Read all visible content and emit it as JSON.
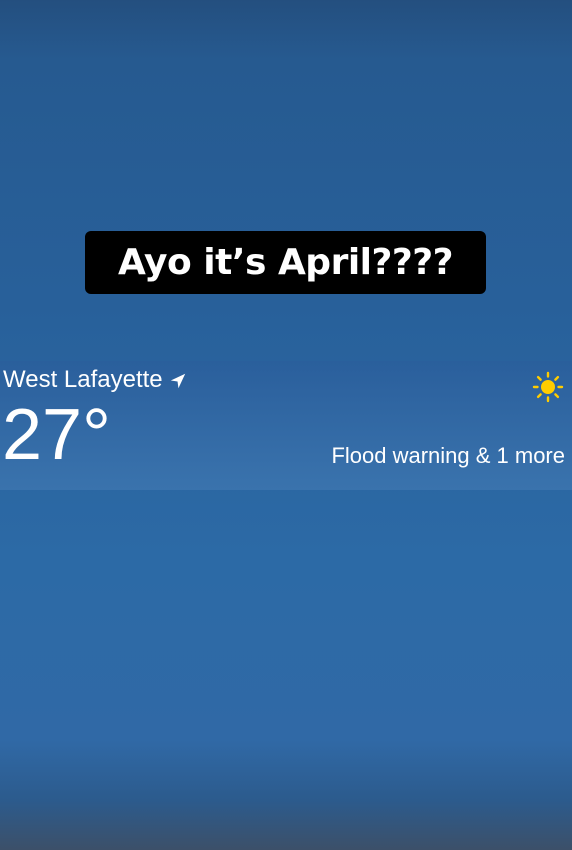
{
  "story": {
    "caption": "Ayo it’s April????"
  },
  "weather": {
    "location": "West Lafayette",
    "location_icon": "location-arrow-icon",
    "temperature": "27°",
    "condition_icon": "sun-icon",
    "alert": "Flood warning & 1 more"
  },
  "colors": {
    "background": "#28609a",
    "caption_bg": "#000000",
    "sun": "#ffcc00"
  }
}
